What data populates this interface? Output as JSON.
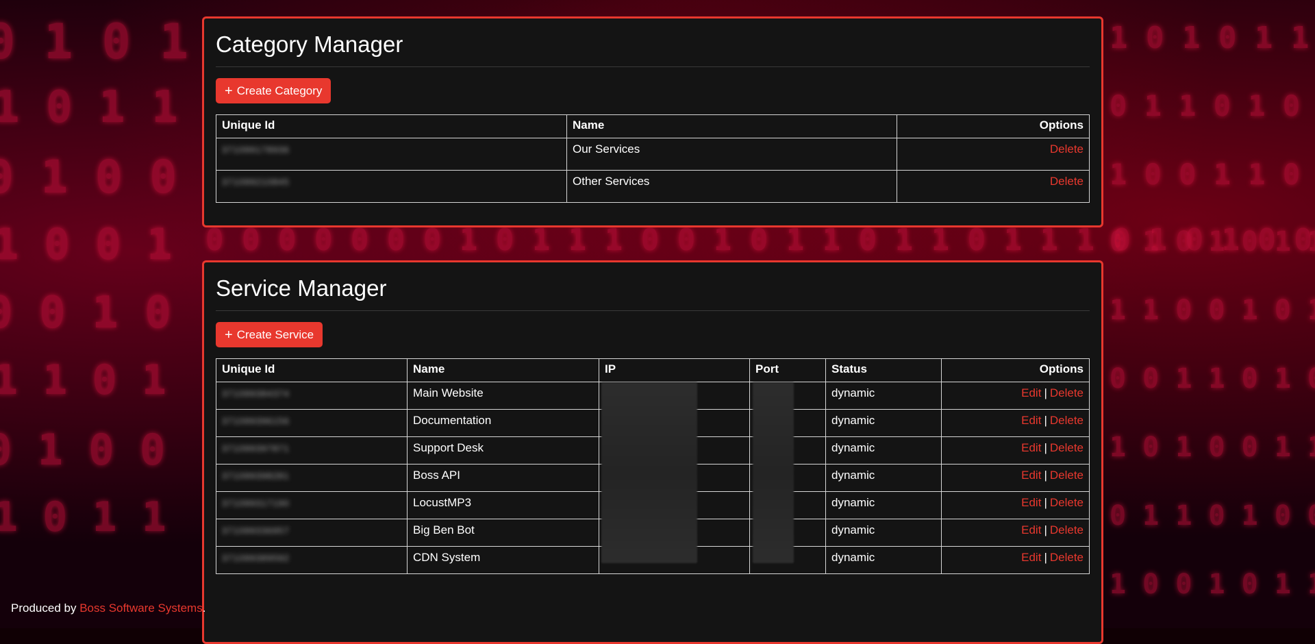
{
  "category_manager": {
    "title": "Category Manager",
    "create_label": "Create Category",
    "columns": [
      "Unique Id",
      "Name",
      "Options"
    ],
    "rows": [
      {
        "id": "371099178936",
        "name": "Our Services",
        "delete": "Delete"
      },
      {
        "id": "371099210845",
        "name": "Other Services",
        "delete": "Delete"
      }
    ]
  },
  "service_manager": {
    "title": "Service Manager",
    "create_label": "Create Service",
    "columns": [
      "Unique Id",
      "Name",
      "IP",
      "Port",
      "Status",
      "Options"
    ],
    "edit_label": "Edit",
    "delete_label": "Delete",
    "separator": "|",
    "rows": [
      {
        "id": "371099384374",
        "name": "Main Website",
        "status": "dynamic"
      },
      {
        "id": "371099396156",
        "name": "Documentation",
        "status": "dynamic"
      },
      {
        "id": "371099397871",
        "name": "Support Desk",
        "status": "dynamic"
      },
      {
        "id": "371099398281",
        "name": "Boss API",
        "status": "dynamic"
      },
      {
        "id": "371099317190",
        "name": "LocustMP3",
        "status": "dynamic"
      },
      {
        "id": "371099336957",
        "name": "Big Ben Bot",
        "status": "dynamic"
      },
      {
        "id": "371099389592",
        "name": "CDN System",
        "status": "dynamic"
      }
    ]
  },
  "footer": {
    "prefix": "Produced by ",
    "link": "Boss Software Systems",
    "suffix": "."
  },
  "colors": {
    "accent": "#e8382e",
    "panel": "#141414",
    "background": "#14000a"
  },
  "icons": {
    "create": "plus-icon"
  }
}
